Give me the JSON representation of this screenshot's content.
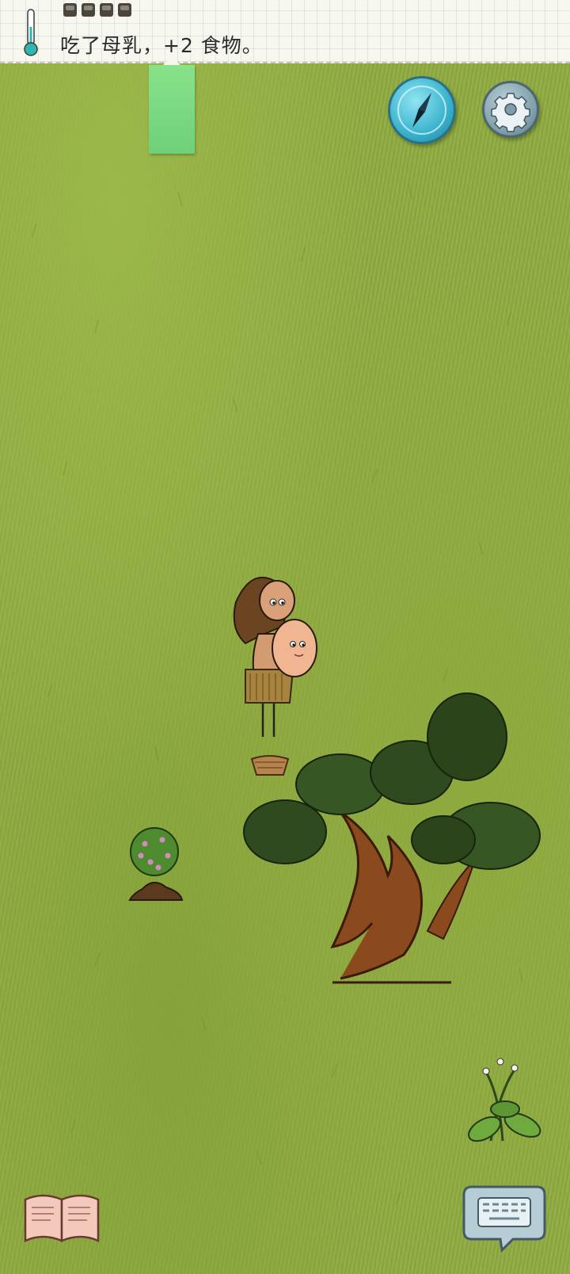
{
  "hud": {
    "message": "吃了母乳，+2 食物。",
    "food_pips": 4,
    "icons": {
      "thermometer": "thermometer-icon",
      "compass": "compass-icon",
      "settings": "gear-icon",
      "book": "book-icon",
      "keyboard": "keyboard-icon"
    }
  },
  "scene": {
    "entities": [
      "mother-with-baby",
      "woven-basket",
      "gooseberry-bush",
      "juniper-tree",
      "wild-plant"
    ]
  },
  "colors": {
    "grass": "#91ad41",
    "paper": "#f7f6ef",
    "compass_blue": "#3ab2cc",
    "tab_green": "#6fd07a"
  }
}
